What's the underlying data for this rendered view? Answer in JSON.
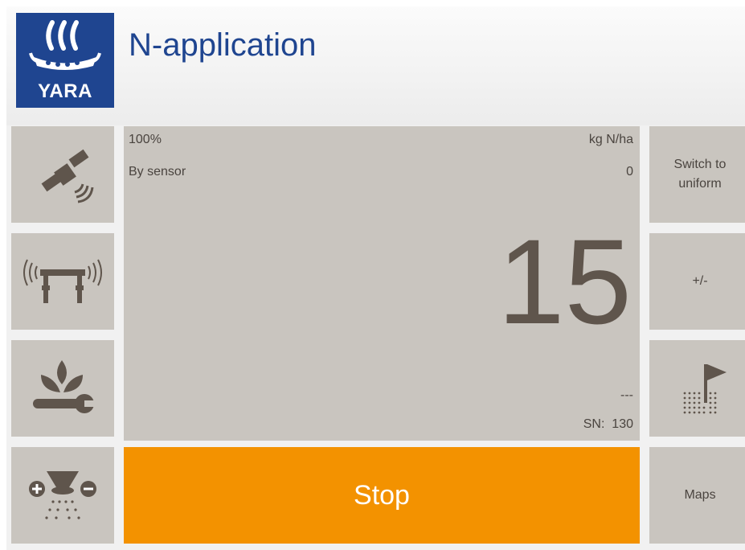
{
  "header": {
    "logo_text": "YARA",
    "title": "N-application"
  },
  "left_tiles": [
    {
      "icon": "satellite-icon"
    },
    {
      "icon": "boom-sensor-icon"
    },
    {
      "icon": "crop-settings-icon"
    },
    {
      "icon": "spreader-rate-icon"
    }
  ],
  "display": {
    "percent": "100%",
    "unit": "kg N/ha",
    "mode": "By sensor",
    "sensor_value": "0",
    "main_value": "15",
    "dashes": "---",
    "sn": "SN:  130"
  },
  "right_tiles": {
    "switch_line1": "Switch to",
    "switch_line2": "uniform",
    "plus_minus": "+/-",
    "flag_icon": "field-flag-icon",
    "maps": "Maps"
  },
  "stop_label": "Stop",
  "colors": {
    "brand_blue": "#1f4590",
    "tile": "#c9c5bf",
    "icon": "#5f554c",
    "stop": "#f39200"
  }
}
